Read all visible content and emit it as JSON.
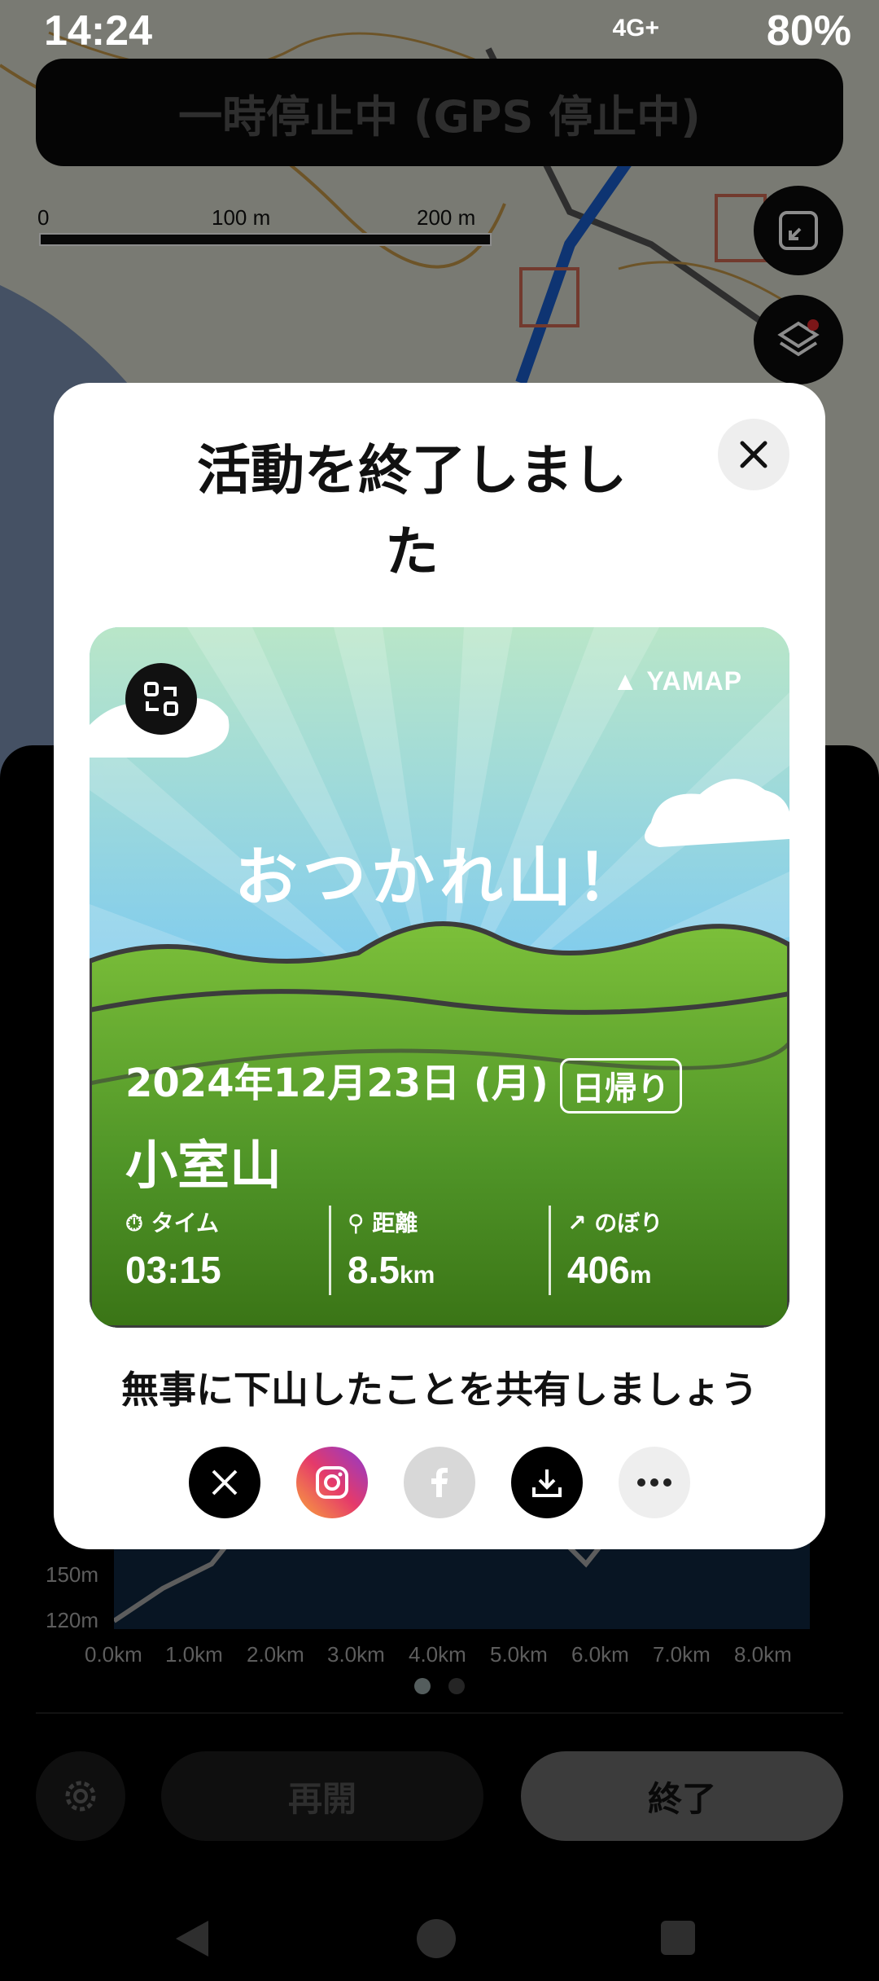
{
  "status_bar": {
    "time": "14:24",
    "network": "4G+",
    "battery": "80%"
  },
  "pause_banner": "一時停止中 (GPS 停止中)",
  "map_scale": {
    "labels": [
      "0",
      "100 m",
      "200 m"
    ]
  },
  "elevation_graph": {
    "y_labels": [
      "150m",
      "120m"
    ],
    "x_labels": [
      "0.0km",
      "1.0km",
      "2.0km",
      "3.0km",
      "4.0km",
      "5.0km",
      "6.0km",
      "7.0km",
      "8.0km"
    ]
  },
  "bottom_bar": {
    "resume": "再開",
    "finish": "終了"
  },
  "dialog": {
    "title": "活動を終了しました",
    "card": {
      "brand": "YAMAP",
      "headline": "おつかれ山！",
      "date": "2024年12月23日 (月)",
      "badge": "日帰り",
      "mountain": "小室山",
      "stats": [
        {
          "label": "タイム",
          "value": "03:15",
          "unit": ""
        },
        {
          "label": "距離",
          "value": "8.5",
          "unit": "km"
        },
        {
          "label": "のぼり",
          "value": "406",
          "unit": "m"
        }
      ]
    },
    "share_title": "無事に下山したことを共有しましょう",
    "share_buttons": [
      "x-icon",
      "instagram-icon",
      "facebook-icon",
      "download-icon",
      "more-icon"
    ]
  }
}
